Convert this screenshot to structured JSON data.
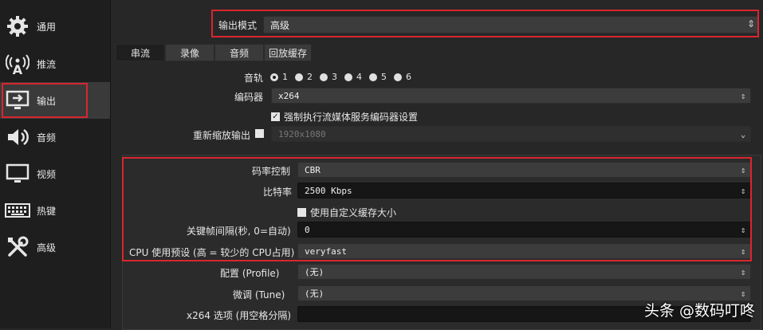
{
  "sidebar": {
    "items": [
      {
        "label": "通用",
        "icon": "gear-icon"
      },
      {
        "label": "推流",
        "icon": "broadcast-antenna-icon"
      },
      {
        "label": "输出",
        "icon": "monitor-output-icon",
        "active": true
      },
      {
        "label": "音频",
        "icon": "speaker-icon"
      },
      {
        "label": "视频",
        "icon": "monitor-icon"
      },
      {
        "label": "热键",
        "icon": "keyboard-icon"
      },
      {
        "label": "高级",
        "icon": "tools-icon"
      }
    ]
  },
  "output_mode": {
    "label": "输出模式",
    "value": "高级"
  },
  "tabs": [
    {
      "label": "串流",
      "active": true
    },
    {
      "label": "录像"
    },
    {
      "label": "音频"
    },
    {
      "label": "回放缓存"
    }
  ],
  "audio_track": {
    "label": "音轨",
    "options": [
      "1",
      "2",
      "3",
      "4",
      "5",
      "6"
    ],
    "selected": "1"
  },
  "encoder": {
    "label": "编码器",
    "value": "x264"
  },
  "enforce_check": {
    "label": "强制执行流媒体服务编码器设置",
    "checked": true
  },
  "rescale": {
    "label": "重新缩放输出",
    "value": "1920x1080",
    "checked": false
  },
  "rate_control": {
    "label": "码率控制",
    "value": "CBR"
  },
  "bitrate": {
    "label": "比特率",
    "value": "2500 Kbps"
  },
  "custom_buffer": {
    "label": "使用自定义缓存大小",
    "checked": false
  },
  "keyframe": {
    "label": "关键帧间隔(秒, 0=自动)",
    "value": "0"
  },
  "cpu_preset": {
    "label": "CPU 使用预设 (高 = 较少的 CPU占用)",
    "value": "veryfast"
  },
  "profile": {
    "label": "配置 (Profile)",
    "value": "(无)"
  },
  "tune": {
    "label": "微调 (Tune)",
    "value": "(无)"
  },
  "x264_options": {
    "label": "x264 选项 (用空格分隔)",
    "value": ""
  },
  "watermark": "头条 @数码叮咚",
  "colors": {
    "highlight": "#d9262e",
    "background": "#272727",
    "sidebar": "#1e1e1e"
  }
}
